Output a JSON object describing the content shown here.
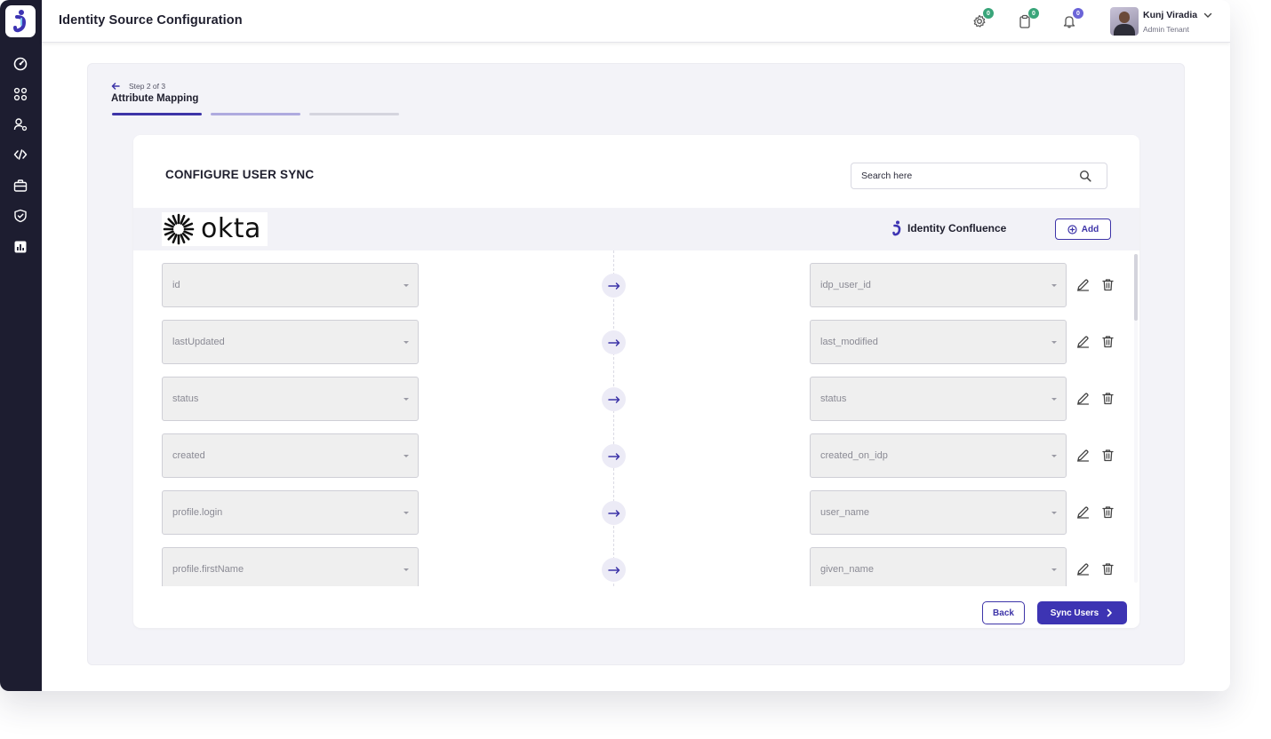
{
  "header": {
    "title": "Identity Source Configuration",
    "badges": {
      "settings": "0",
      "clipboard": "0",
      "notifications": "0"
    },
    "user": {
      "name": "Kunj Viradia",
      "role": "Admin Tenant"
    }
  },
  "stepper": {
    "step_label": "Step 2 of 3",
    "title": "Attribute Mapping",
    "progress_colors": [
      "#3d34a8",
      "#aeaadf",
      "#d4d4de"
    ]
  },
  "card": {
    "title": "CONFIGURE USER SYNC",
    "search_placeholder": "Search here",
    "source_logo_text": "okta",
    "target_name": "Identity Confluence",
    "add_label": "Add"
  },
  "mappings": [
    {
      "source": "id",
      "target": "idp_user_id"
    },
    {
      "source": "lastUpdated",
      "target": "last_modified"
    },
    {
      "source": "status",
      "target": "status"
    },
    {
      "source": "created",
      "target": "created_on_idp"
    },
    {
      "source": "profile.login",
      "target": "user_name"
    },
    {
      "source": "profile.firstName",
      "target": "given_name"
    }
  ],
  "footer": {
    "back_label": "Back",
    "sync_label": "Sync Users"
  },
  "colors": {
    "accent": "#3d34b3",
    "sidebar": "#1d1d30",
    "badge_green": "#3aa57a",
    "badge_purple": "#6b64d8"
  }
}
